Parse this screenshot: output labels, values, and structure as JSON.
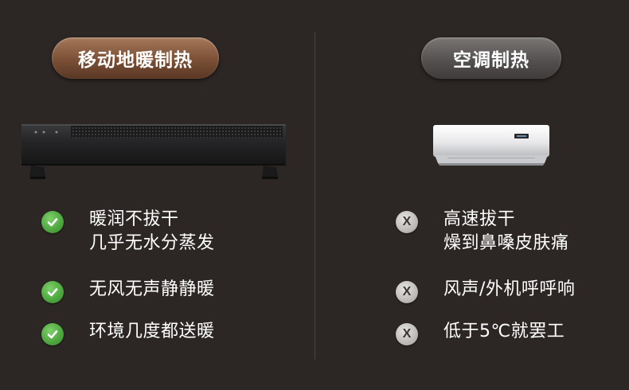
{
  "left": {
    "title": "移动地暖制热",
    "image": "baseboard-heater",
    "features": [
      {
        "lines": [
          "暖润不拔干",
          "几乎无水分蒸发"
        ]
      },
      {
        "lines": [
          "无风无声静静暖"
        ]
      },
      {
        "lines": [
          "环境几度都送暖"
        ]
      }
    ],
    "icon": "check-icon",
    "accent": "#4ca53e"
  },
  "right": {
    "title": "空调制热",
    "image": "air-conditioner",
    "features": [
      {
        "lines": [
          "高速拔干",
          "燥到鼻嗓皮肤痛"
        ]
      },
      {
        "lines": [
          "风声/外机呼呼响"
        ]
      },
      {
        "lines": [
          "低于5℃就罢工"
        ]
      }
    ],
    "icon": "cross-icon",
    "icon_glyph": "X",
    "accent": "#bdbab8"
  },
  "colors": {
    "background": "#2c2624",
    "left_pill": "#7a4f35",
    "right_pill": "#545150"
  }
}
